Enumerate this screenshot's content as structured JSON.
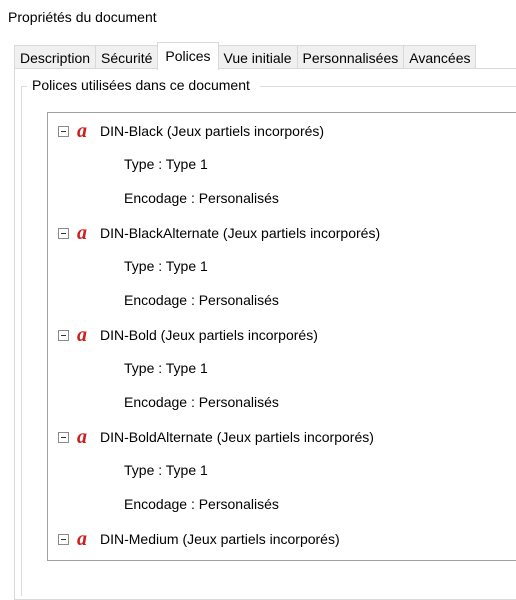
{
  "window": {
    "title": "Propriétés du document"
  },
  "tabs": [
    {
      "label": "Description"
    },
    {
      "label": "Sécurité"
    },
    {
      "label": "Polices"
    },
    {
      "label": "Vue initiale"
    },
    {
      "label": "Personnalisées"
    },
    {
      "label": "Avancées"
    }
  ],
  "active_tab": "Polices",
  "group": {
    "legend": "Polices utilisées dans ce document"
  },
  "fonts": [
    {
      "name": "DIN-Black (Jeux partiels incorporés)",
      "type": "Type : Type 1",
      "encoding": "Encodage : Personalisés"
    },
    {
      "name": "DIN-BlackAlternate (Jeux partiels incorporés)",
      "type": "Type : Type 1",
      "encoding": "Encodage : Personalisés"
    },
    {
      "name": "DIN-Bold (Jeux partiels incorporés)",
      "type": "Type : Type 1",
      "encoding": "Encodage : Personalisés"
    },
    {
      "name": "DIN-BoldAlternate (Jeux partiels incorporés)",
      "type": "Type : Type 1",
      "encoding": "Encodage : Personalisés"
    },
    {
      "name": "DIN-Medium (Jeux partiels incorporés)"
    }
  ],
  "colors": {
    "font_icon": "#cc1f1f",
    "border": "#a0a0a0"
  },
  "icons": {
    "font": "font-a-icon",
    "collapse": "minus-box-icon"
  }
}
